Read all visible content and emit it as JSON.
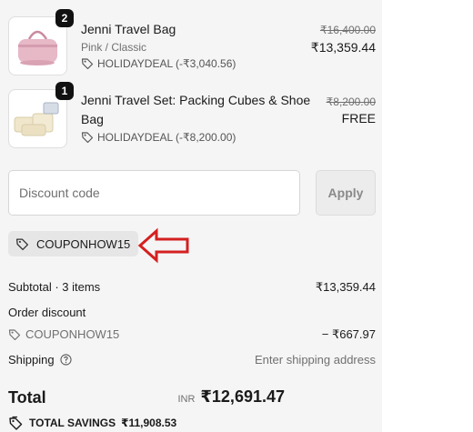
{
  "items": [
    {
      "title": "Jenni Travel Bag",
      "variant": "Pink / Classic",
      "quantity": "2",
      "discount": "HOLIDAYDEAL (-₹3,040.56)",
      "original_price": "₹16,400.00",
      "price": "₹13,359.44",
      "image": "pink-travel-bag"
    },
    {
      "title": "Jenni Travel Set: Packing Cubes & Shoe Bag",
      "title_line1": "Jenni Travel Set: Packing Cubes & Shoe",
      "title_line2": "Bag",
      "quantity": "1",
      "discount": "HOLIDAYDEAL (-₹8,200.00)",
      "original_price": "₹8,200.00",
      "price": "FREE",
      "image": "packing-cubes-set"
    }
  ],
  "discount": {
    "placeholder": "Discount code",
    "apply_label": "Apply"
  },
  "applied_coupon": "COUPONHOW15",
  "summary": {
    "subtotal_label": "Subtotal · 3 items",
    "subtotal_value": "₹13,359.44",
    "order_discount_label": "Order discount",
    "coupon_code": "COUPONHOW15",
    "coupon_value": "− ₹667.97",
    "shipping_label": "Shipping",
    "shipping_value": "Enter shipping address",
    "total_label": "Total",
    "currency": "INR",
    "total_value": "₹12,691.47",
    "savings_label": "TOTAL SAVINGS",
    "savings_value": "₹11,908.53"
  },
  "colors": {
    "panel_bg": "#f5f5f5",
    "annotation_arrow": "#d42020"
  },
  "icons": [
    "tag-icon",
    "help-circle-icon",
    "savings-tag-icon",
    "red-arrow-annotation"
  ]
}
